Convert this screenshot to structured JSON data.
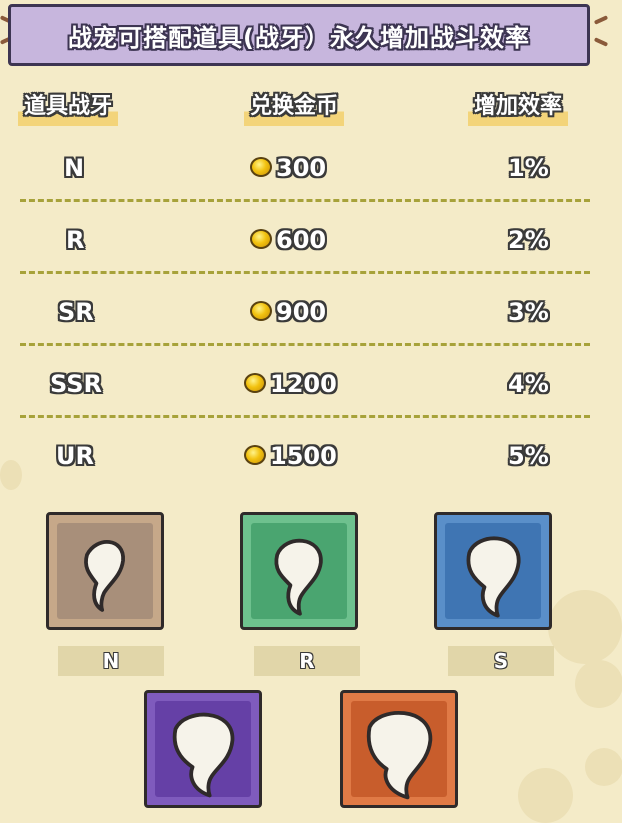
{
  "banner": {
    "title": "战宠可搭配道具(战牙）永久增加战斗效率"
  },
  "table": {
    "headers": {
      "item": "道具战牙",
      "cost": "兑换金币",
      "boost": "增加效率"
    },
    "rows": [
      {
        "grade": "N",
        "coins": "300",
        "boost": "1%"
      },
      {
        "grade": "R",
        "coins": "600",
        "boost": "2%"
      },
      {
        "grade": "SR",
        "coins": "900",
        "boost": "3%"
      },
      {
        "grade": "SSR",
        "coins": "1200",
        "boost": "4%"
      },
      {
        "grade": "UR",
        "coins": "1500",
        "boost": "5%"
      }
    ]
  },
  "cards": [
    {
      "label": "N",
      "frame_color": "#c6a889",
      "inner_color": "#a88f7a",
      "icon": "fang-icon"
    },
    {
      "label": "R",
      "frame_color": "#6ec18e",
      "inner_color": "#4aa570",
      "icon": "fang-icon"
    },
    {
      "label": "S",
      "frame_color": "#5a8fc9",
      "inner_color": "#3f75b3",
      "icon": "fang-icon"
    },
    {
      "label": "",
      "frame_color": "#7f5bbd",
      "inner_color": "#6540a6",
      "icon": "fang-icon"
    },
    {
      "label": "",
      "frame_color": "#e07a46",
      "inner_color": "#c85d2c",
      "icon": "fang-icon"
    }
  ],
  "colors": {
    "background": "#f4ebc8",
    "banner": "#c7b6dd",
    "divider": "#a7a23a",
    "coin": "#f2c20f"
  }
}
